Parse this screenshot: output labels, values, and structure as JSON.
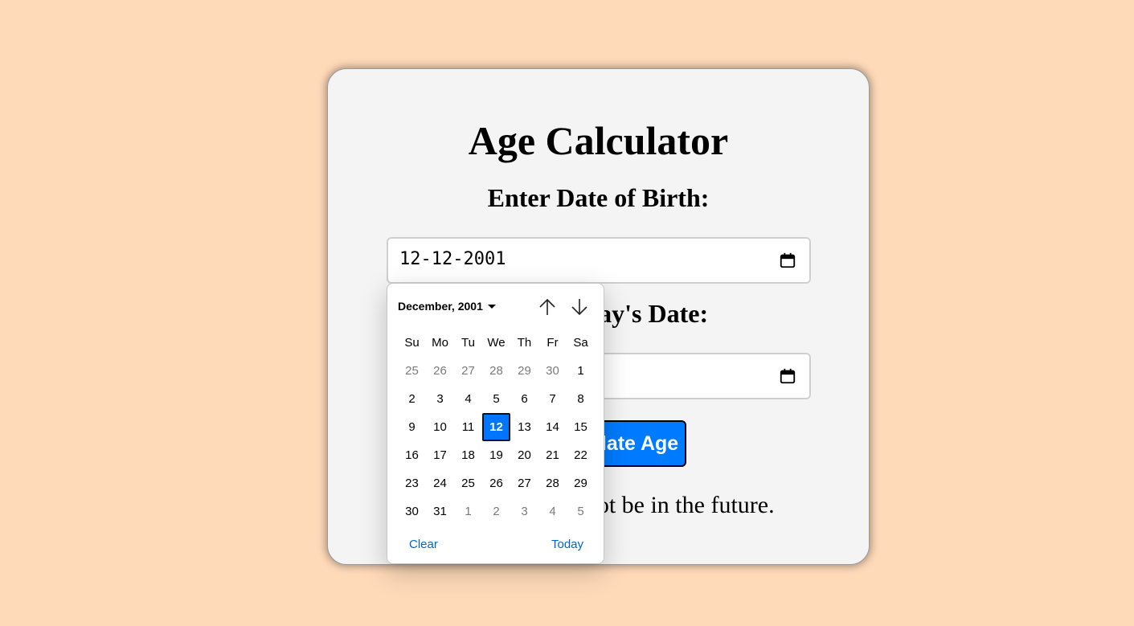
{
  "app": {
    "title": "Age Calculator",
    "dob_label": "Enter Date of Birth:",
    "today_label": "Enter Today's Date:",
    "dob_value": "12-12-2001",
    "today_value": "",
    "button_label": "Calculate Age",
    "message": "Date of birth cannot be in the future."
  },
  "datepicker": {
    "month_label": "December, 2001",
    "weekdays": [
      "Su",
      "Mo",
      "Tu",
      "We",
      "Th",
      "Fr",
      "Sa"
    ],
    "weeks": [
      [
        "25",
        "26",
        "27",
        "28",
        "29",
        "30",
        "1"
      ],
      [
        "2",
        "3",
        "4",
        "5",
        "6",
        "7",
        "8"
      ],
      [
        "9",
        "10",
        "11",
        "12",
        "13",
        "14",
        "15"
      ],
      [
        "16",
        "17",
        "18",
        "19",
        "20",
        "21",
        "22"
      ],
      [
        "23",
        "24",
        "25",
        "26",
        "27",
        "28",
        "29"
      ],
      [
        "30",
        "31",
        "1",
        "2",
        "3",
        "4",
        "5"
      ]
    ],
    "selected_day": "12",
    "clear_label": "Clear",
    "today_label": "Today"
  },
  "colors": {
    "background": "#ffdab9",
    "card": "#f4f4f4",
    "accent": "#007bff",
    "selected_day": "#0075ff",
    "link": "#0066cc"
  },
  "icons": {
    "calendar": "calendar-icon",
    "prev": "arrow-up-icon",
    "next": "arrow-down-icon",
    "month_caret": "caret-down-icon"
  }
}
